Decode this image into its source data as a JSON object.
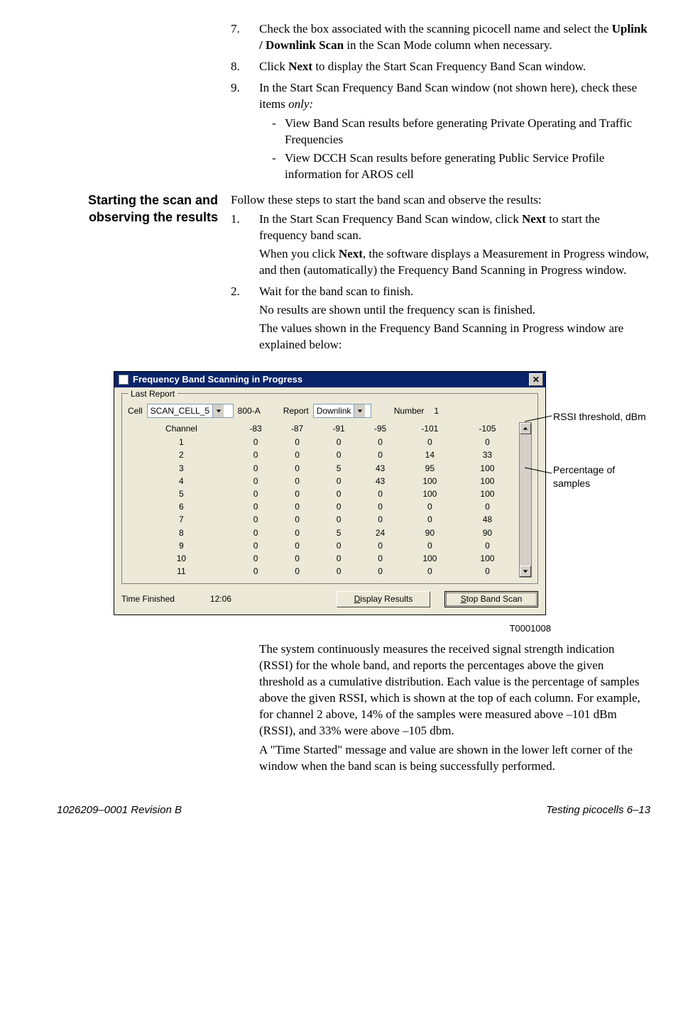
{
  "steps_top": [
    {
      "num": "7.",
      "paras": [
        {
          "t": "Check the box associated with the scanning picocell name and select the ",
          "b": "Uplink / Downlink Scan",
          "t2": " in the Scan Mode column when necessary."
        }
      ]
    },
    {
      "num": "8.",
      "paras": [
        {
          "t": "Click ",
          "b": "Next",
          "t2": " to display the Start Scan Frequency Band Scan window."
        }
      ]
    },
    {
      "num": "9.",
      "paras": [
        {
          "t": "In the Start Scan Frequency Band Scan window (not shown here), check these items ",
          "i": "only:"
        }
      ],
      "dashes": [
        "View Band Scan results before generating Private Operating and Traffic Frequencies",
        "View DCCH Scan results before generating Public Service Profile information for AROS cell"
      ]
    }
  ],
  "side_heading": "Starting the scan and observing the results",
  "intro2": "Follow these steps to start the band scan and observe the results:",
  "steps_mid": [
    {
      "num": "1.",
      "paras": [
        {
          "t": "In the Start Scan Frequency Band Scan window, click ",
          "b": "Next",
          "t2": " to start the frequency band scan."
        },
        {
          "t": "When you click ",
          "b": "Next",
          "t2": ", the software displays a Measurement in Progress window, and then (automatically) the Frequency Band Scanning in Progress window."
        }
      ]
    },
    {
      "num": "2.",
      "paras": [
        {
          "t": "Wait for the band scan to finish."
        },
        {
          "t": "No results are shown until the frequency scan is finished."
        },
        {
          "t": "The values shown in the Frequency Band Scanning in Progress window are explained below:"
        }
      ]
    }
  ],
  "window": {
    "title": "Frequency Band Scanning in Progress",
    "legend": "Last Report",
    "cell_label": "Cell",
    "cell_value": "SCAN_CELL_5",
    "band": "800-A",
    "report_label": "Report",
    "report_value": "Downlink",
    "number_label": "Number",
    "number_value": "1",
    "headers": [
      "Channel",
      "-83",
      "-87",
      "-91",
      "-95",
      "-101",
      "-105"
    ],
    "rows": [
      [
        "1",
        "0",
        "0",
        "0",
        "0",
        "0",
        "0"
      ],
      [
        "2",
        "0",
        "0",
        "0",
        "0",
        "14",
        "33"
      ],
      [
        "3",
        "0",
        "0",
        "5",
        "43",
        "95",
        "100"
      ],
      [
        "4",
        "0",
        "0",
        "0",
        "43",
        "100",
        "100"
      ],
      [
        "5",
        "0",
        "0",
        "0",
        "0",
        "100",
        "100"
      ],
      [
        "6",
        "0",
        "0",
        "0",
        "0",
        "0",
        "0"
      ],
      [
        "7",
        "0",
        "0",
        "0",
        "0",
        "0",
        "48"
      ],
      [
        "8",
        "0",
        "0",
        "5",
        "24",
        "90",
        "90"
      ],
      [
        "9",
        "0",
        "0",
        "0",
        "0",
        "0",
        "0"
      ],
      [
        "10",
        "0",
        "0",
        "0",
        "0",
        "100",
        "100"
      ],
      [
        "11",
        "0",
        "0",
        "0",
        "0",
        "0",
        "0"
      ]
    ],
    "time_finished_label": "Time Finished",
    "time_finished_value": "12:06",
    "display_results": "Display Results",
    "stop_band_scan": "Stop Band Scan"
  },
  "anno1": "RSSI threshold, dBm",
  "anno2": "Percentage of samples",
  "fig_id": "T0001008",
  "after_paras": [
    "The system continuously measures the received signal strength indication (RSSI) for the whole band, and reports the percentages above the given threshold as a cumulative distribution. Each value is the percentage of samples above the given RSSI, which is shown at the top of each column. For example, for channel 2 above, 14% of the samples were measured above –101 dBm (RSSI), and 33% were above –105 dbm.",
    "A \"Time Started\" message and value are shown in the lower left corner of the window when the band scan is being successfully performed."
  ],
  "footer_left": "1026209–0001  Revision B",
  "footer_right": "Testing picocells   6–13"
}
